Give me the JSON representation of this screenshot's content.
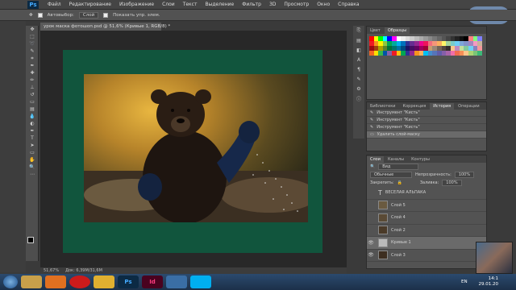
{
  "menu": {
    "logo": "Ps",
    "items": [
      "Файл",
      "Редактирование",
      "Изображение",
      "Слои",
      "Текст",
      "Выделение",
      "Фильтр",
      "3D",
      "Просмотр",
      "Окно",
      "Справка"
    ]
  },
  "overlay": {
    "skype": "Skype"
  },
  "options": {
    "autoselect": "Автовыбор:",
    "autoselect_value": "Слой",
    "transform": "Показать упр. элем."
  },
  "document": {
    "tab": "урок маска фотошоп.psd @ 51,6% (Кривые 1, RGB/8) *",
    "zoom": "51,67%",
    "doc_info": "Док: 6,39M/31,6M"
  },
  "swatches_panel": {
    "tabs": [
      "Цвет",
      "Образцы"
    ],
    "colors": [
      "#ff0000",
      "#ffff00",
      "#00ff00",
      "#00ffff",
      "#0000ff",
      "#ff00ff",
      "#ffffff",
      "#eeeeee",
      "#dddddd",
      "#cccccc",
      "#bbbbbb",
      "#aaaaaa",
      "#999999",
      "#888888",
      "#777777",
      "#666666",
      "#555555",
      "#444444",
      "#333333",
      "#222222",
      "#111111",
      "#000000",
      "#ff8080",
      "#80ff80",
      "#8080ff",
      "#ee1c24",
      "#f7941d",
      "#fff200",
      "#8dc63f",
      "#00a651",
      "#00a99d",
      "#00aeef",
      "#0072bc",
      "#2e3192",
      "#662d91",
      "#92278f",
      "#ec008c",
      "#ed145b",
      "#f26d7d",
      "#f69679",
      "#fbaf5d",
      "#fff568",
      "#a3d39c",
      "#7accc8",
      "#6dcff6",
      "#7da7d9",
      "#8393ca",
      "#a186be",
      "#f49ac1",
      "#c7b299",
      "#9e0b0f",
      "#a0410d",
      "#aba000",
      "#598527",
      "#007236",
      "#00746b",
      "#0076a3",
      "#004a80",
      "#1b1464",
      "#440e62",
      "#630460",
      "#9e005d",
      "#9e0039",
      "#c69c6d",
      "#998675",
      "#736357",
      "#534741",
      "#362f2d",
      "#fdc689",
      "#bd8cbf",
      "#c4df9b",
      "#82ca9c",
      "#6ecff6",
      "#8781bd",
      "#f5989d",
      "#f26522",
      "#ffde00",
      "#39b54a",
      "#0054a6",
      "#8560a8",
      "#ed1c24",
      "#ffc20e",
      "#00a651",
      "#2e3192",
      "#92278f",
      "#f7941d",
      "#fbaf5d",
      "#00bff3",
      "#448ccb",
      "#5674b9",
      "#605ca8",
      "#855fa8",
      "#a864a8",
      "#f06ea9",
      "#f26c4f",
      "#f68e56",
      "#fdc68a",
      "#acd373",
      "#7cc576",
      "#3cb878"
    ]
  },
  "history_panel": {
    "tabs": [
      "Библиотеки",
      "Коррекция",
      "История",
      "Операции"
    ],
    "items": [
      "Инструмент \"Кисть\"",
      "Инструмент \"Кисть\"",
      "Инструмент \"Кисть\"",
      "Удалить слой-маску"
    ]
  },
  "layers_panel": {
    "tabs": [
      "Слои",
      "Каналы",
      "Контуры"
    ],
    "kind": "Вид",
    "blend": "Обычные",
    "opacity_label": "Непрозрачность:",
    "opacity": "100%",
    "lock_label": "Закрепить:",
    "fill_label": "Заливка:",
    "fill": "100%",
    "layers": [
      {
        "name": "ВЕСЕЛАЯ АЛЬПАКА",
        "type": "text"
      },
      {
        "name": "Слой 5",
        "type": "image"
      },
      {
        "name": "Слой 4",
        "type": "image"
      },
      {
        "name": "Слой 2",
        "type": "image"
      },
      {
        "name": "Кривые 1",
        "type": "adjust"
      },
      {
        "name": "Слой 3",
        "type": "image"
      }
    ]
  },
  "taskbar": {
    "apps": [
      "",
      "",
      "",
      "",
      "Ps",
      "Id",
      "",
      ""
    ],
    "lang": "EN",
    "time": "14:1",
    "date": "29.01.20"
  }
}
